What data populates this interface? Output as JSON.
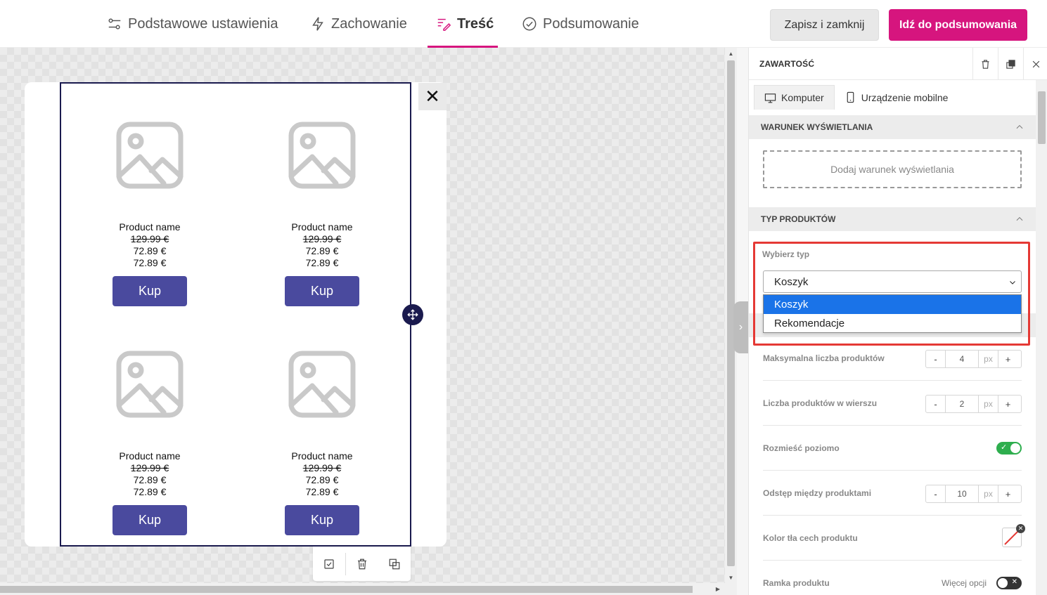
{
  "nav": {
    "tabs": [
      {
        "label": "Podstawowe ustawienia",
        "icon": "sliders-icon"
      },
      {
        "label": "Zachowanie",
        "icon": "lightning-icon"
      },
      {
        "label": "Treść",
        "icon": "content-icon"
      },
      {
        "label": "Podsumowanie",
        "icon": "check-circle-icon"
      }
    ],
    "active_tab": "Treść",
    "save_close_label": "Zapisz i zamknij",
    "go_summary_label": "Idź do podsumowania",
    "accent_color": "#d6157e"
  },
  "canvas": {
    "close_symbol": "✕",
    "products": [
      {
        "name": "Product name",
        "old_price": "129.99 €",
        "price": "72.89 €",
        "price2": "72.89 €",
        "button": "Kup"
      },
      {
        "name": "Product name",
        "old_price": "129.99 €",
        "price": "72.89 €",
        "price2": "72.89 €",
        "button": "Kup"
      },
      {
        "name": "Product name",
        "old_price": "129.99 €",
        "price": "72.89 €",
        "price2": "72.89 €",
        "button": "Kup"
      },
      {
        "name": "Product name",
        "old_price": "129.99 €",
        "price": "72.89 €",
        "price2": "72.89 €",
        "button": "Kup"
      }
    ],
    "button_color": "#4a4a9e"
  },
  "panel": {
    "title": "ZAWARTOŚĆ",
    "device_tabs": [
      {
        "label": "Komputer",
        "icon": "monitor-icon"
      },
      {
        "label": "Urządzenie mobilne",
        "icon": "mobile-icon"
      }
    ],
    "display_condition": {
      "heading": "WARUNEK WYŚWIETLANIA",
      "add_label": "Dodaj warunek wyświetlania"
    },
    "product_type": {
      "heading": "TYP PRODUKTÓW",
      "select_label": "Wybierz typ",
      "selected": "Koszyk",
      "options": [
        "Koszyk",
        "Rekomendacje"
      ]
    },
    "settings": {
      "max_products": {
        "label": "Maksymalna liczba produktów",
        "value": "4",
        "unit": "px"
      },
      "per_row": {
        "label": "Liczba produktów w wierszu",
        "value": "2",
        "unit": "px"
      },
      "horizontal": {
        "label": "Rozmieść poziomo",
        "on": true
      },
      "spacing": {
        "label": "Odstęp między produktami",
        "value": "10",
        "unit": "px"
      },
      "bg_color": {
        "label": "Kolor tła cech produktu"
      },
      "border": {
        "label": "Ramka produktu",
        "more_label": "Więcej opcji",
        "on": false
      }
    },
    "stepper_minus": "-",
    "stepper_plus": "+"
  }
}
